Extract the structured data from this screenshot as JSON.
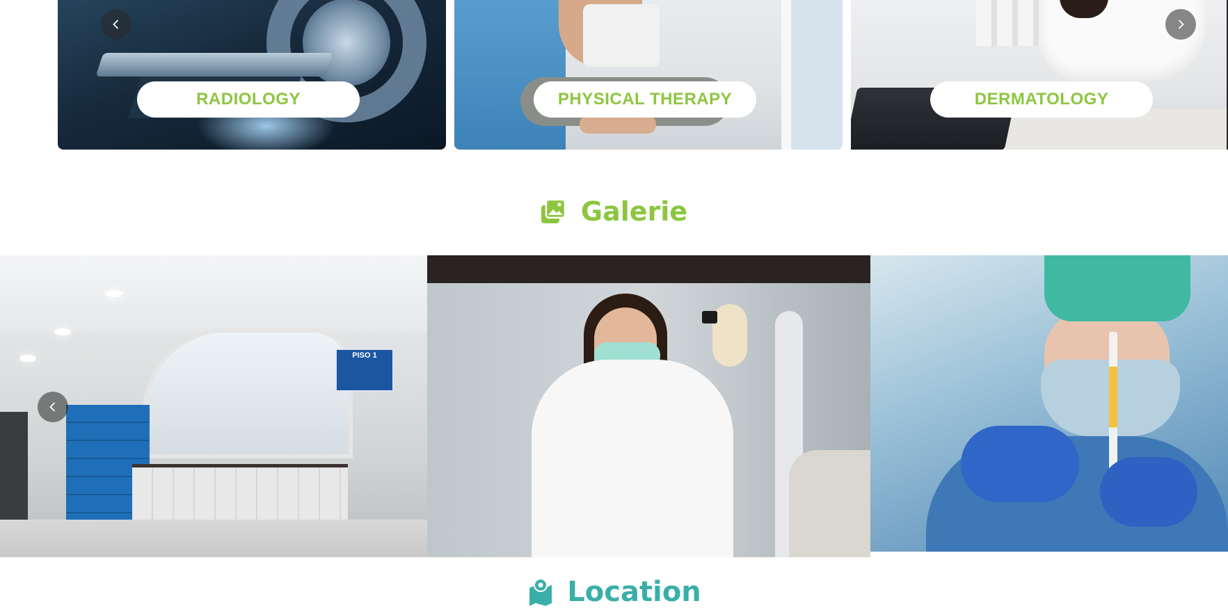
{
  "services": {
    "cards": [
      {
        "label": "RADIOLOGY"
      },
      {
        "label": "PHYSICAL THERAPY"
      },
      {
        "label": "DERMATOLOGY"
      }
    ],
    "prev_icon": "chevron-left-icon",
    "next_icon": "chevron-right-icon"
  },
  "gallery": {
    "title": "Galerie",
    "icon": "image-icon",
    "images": [
      {
        "name": "reception-lobby",
        "sign": "PISO 1"
      },
      {
        "name": "lab-technician"
      },
      {
        "name": "doctor-syringe"
      }
    ],
    "prev_icon": "chevron-left-icon"
  },
  "location": {
    "title": "Location",
    "icon": "map-pin-icon"
  },
  "colors": {
    "accent_green": "#8cc63f",
    "accent_teal": "#3aafa9"
  }
}
